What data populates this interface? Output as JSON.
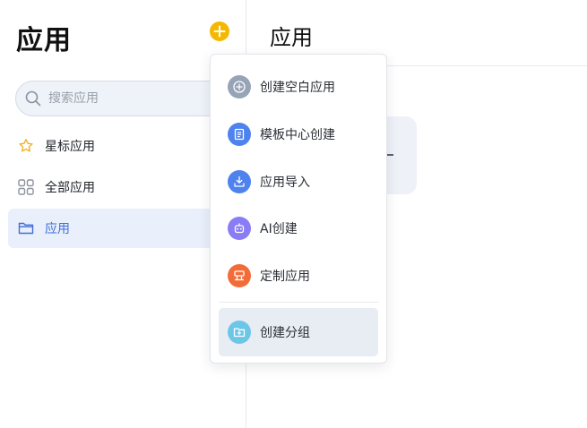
{
  "sidebar": {
    "title": "应用",
    "search": {
      "placeholder": "搜索应用",
      "value": ""
    },
    "items": [
      {
        "label": "星标应用",
        "icon": "star-icon"
      },
      {
        "label": "全部应用",
        "icon": "grid-icon"
      },
      {
        "label": "应用",
        "icon": "folder-icon",
        "active": true
      }
    ]
  },
  "main": {
    "title": "应用"
  },
  "dropdown": {
    "items": [
      {
        "label": "创建空白应用",
        "icon": "plus-circle-icon",
        "color": "#97a3b6"
      },
      {
        "label": "模板中心创建",
        "icon": "template-icon",
        "color": "#4e82ee"
      },
      {
        "label": "应用导入",
        "icon": "import-icon",
        "color": "#4e82ee"
      },
      {
        "label": "AI创建",
        "icon": "robot-icon",
        "color": "#8a7cf4"
      },
      {
        "label": "定制应用",
        "icon": "custom-icon",
        "color": "#f26c3a"
      },
      {
        "label": "创建分组",
        "icon": "group-folder-icon",
        "color": "#6cc6e8"
      }
    ]
  },
  "colors": {
    "accent": "#f5b800",
    "active_nav": "#3d6fd8"
  }
}
